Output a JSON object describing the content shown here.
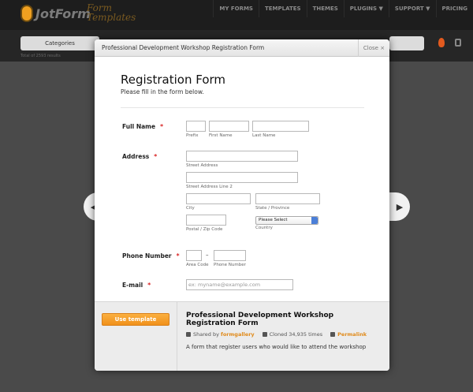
{
  "brand": {
    "logo": "JotForm",
    "sub": "Form Templates"
  },
  "nav": {
    "items": [
      "MY FORMS",
      "TEMPLATES",
      "THEMES",
      "PLUGINS ▼",
      "SUPPORT ▼",
      "PRICING"
    ]
  },
  "subbar": {
    "category": "Categories",
    "total": "Total of 2593 results"
  },
  "modal": {
    "title": "Professional Development Workshop Registration Form",
    "close": "Close ×"
  },
  "form": {
    "title": "Registration Form",
    "subtitle": "Please fill in the form below.",
    "required_mark": "*",
    "full_name": {
      "label": "Full Name",
      "prefix": "Prefix",
      "first": "First Name",
      "last": "Last Name"
    },
    "address": {
      "label": "Address",
      "street": "Street Address",
      "street2": "Street Address Line 2",
      "city": "City",
      "state": "State / Province",
      "zip": "Postal / Zip Code",
      "country": "Country",
      "country_value": "Please Select"
    },
    "phone": {
      "label": "Phone Number",
      "area": "Area Code",
      "number": "Phone Number",
      "dash": "–"
    },
    "email": {
      "label": "E-mail",
      "placeholder": "ex: myname@example.com"
    }
  },
  "template": {
    "use_button": "Use template",
    "title": "Professional Development Workshop Registration Form",
    "shared_by_prefix": "Shared by",
    "shared_by": "formgallery",
    "cloned": "Cloned 34,935 times",
    "permalink": "Permalink",
    "description": "A form that register users who would like to attend the workshop"
  },
  "colors": {
    "accent": "#f0901a",
    "required": "#d82020",
    "topbar": "#1d1d1d"
  }
}
